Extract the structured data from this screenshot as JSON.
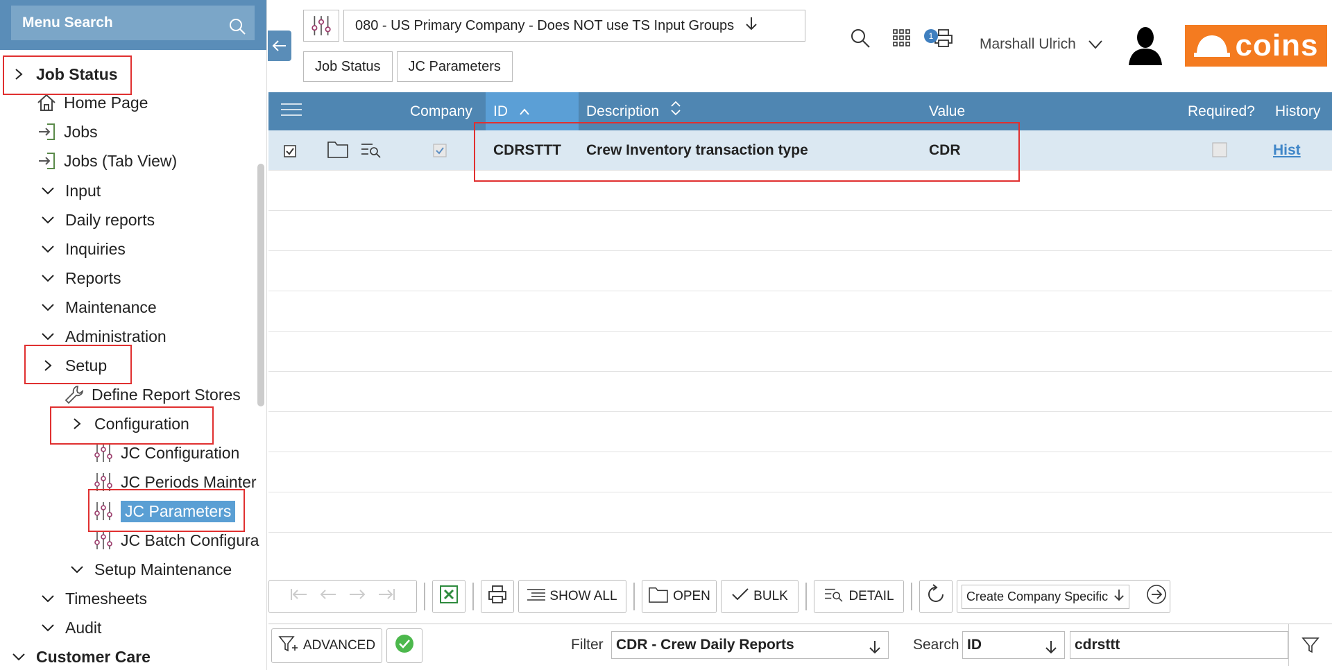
{
  "sidebar": {
    "menu_search_placeholder": "Menu Search",
    "items": [
      {
        "label": "Job Status"
      },
      {
        "label": "Home Page"
      },
      {
        "label": "Jobs"
      },
      {
        "label": "Jobs (Tab View)"
      },
      {
        "label": "Input"
      },
      {
        "label": "Daily reports"
      },
      {
        "label": "Inquiries"
      },
      {
        "label": "Reports"
      },
      {
        "label": "Maintenance"
      },
      {
        "label": "Administration"
      },
      {
        "label": "Setup"
      },
      {
        "label": "Define Report Stores"
      },
      {
        "label": "Configuration"
      },
      {
        "label": "JC Configuration"
      },
      {
        "label": "JC Periods Mainter"
      },
      {
        "label": "JC Parameters"
      },
      {
        "label": "JC Batch Configura"
      },
      {
        "label": "Setup Maintenance"
      },
      {
        "label": "Timesheets"
      },
      {
        "label": "Audit"
      },
      {
        "label": "Customer Care"
      }
    ]
  },
  "header": {
    "company": "080 - US Primary Company - Does NOT use TS Input Groups",
    "tabs": [
      "Job Status",
      "JC Parameters"
    ],
    "print_badge": "1",
    "user_name": "Marshall Ulrich",
    "logo_text": "coins"
  },
  "grid": {
    "columns": {
      "company": "Company",
      "id": "ID",
      "description": "Description",
      "value": "Value",
      "required": "Required?",
      "history": "History"
    },
    "rows": [
      {
        "id": "CDRSTTT",
        "description": "Crew Inventory transaction type",
        "value": "CDR",
        "history": "Hist"
      }
    ]
  },
  "toolbar": {
    "show_all": "SHOW ALL",
    "open": "OPEN",
    "bulk": "BULK",
    "detail": "DETAIL",
    "create_select": "Create Company Specific"
  },
  "filterbar": {
    "advanced": "ADVANCED",
    "filter_label": "Filter",
    "filter_value": "CDR - Crew Daily Reports",
    "search_label": "Search",
    "search_field": "ID",
    "search_value": "cdrsttt"
  },
  "colors": {
    "header_blue": "#4f86b2",
    "selected_blue": "#5a9fd4",
    "row_highlight": "#dbe8f2",
    "logo_orange": "#f47b20",
    "annotation_red": "#e03030"
  }
}
